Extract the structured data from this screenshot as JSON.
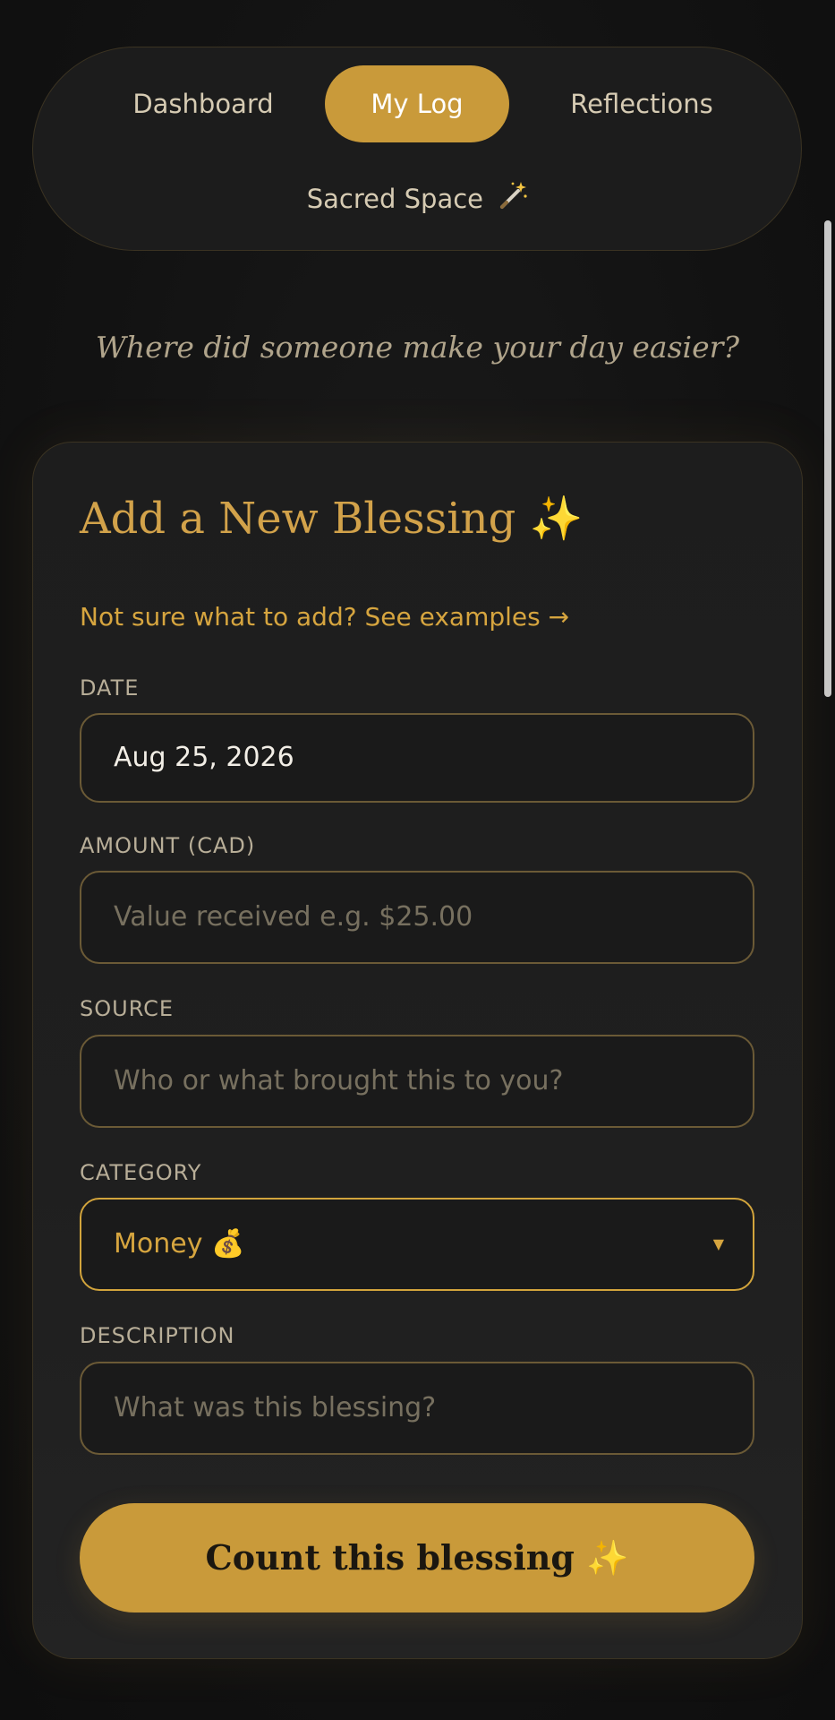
{
  "nav": {
    "items": [
      {
        "label": "Dashboard",
        "active": false
      },
      {
        "label": "My Log",
        "active": true
      },
      {
        "label": "Reflections",
        "active": false
      },
      {
        "label": "Sacred Space",
        "active": false,
        "icon": "magic-wand-icon"
      }
    ]
  },
  "prompt": "Where did someone make your day easier?",
  "form": {
    "title": "Add a New Blessing ✨",
    "examples_link": "Not sure what to add? See examples →",
    "date": {
      "label": "DATE",
      "value": "Aug 25, 2026"
    },
    "amount": {
      "label": "AMOUNT (CAD)",
      "placeholder": "Value received e.g. $25.00"
    },
    "source": {
      "label": "SOURCE",
      "placeholder": "Who or what brought this to you?"
    },
    "category": {
      "label": "CATEGORY",
      "value": "Money 💰"
    },
    "description": {
      "label": "DESCRIPTION",
      "placeholder": "What was this blessing?"
    },
    "submit_label": "Count this blessing ✨"
  },
  "colors": {
    "accent": "#c99a3a",
    "background": "#121212",
    "card": "#1e1e1e"
  }
}
